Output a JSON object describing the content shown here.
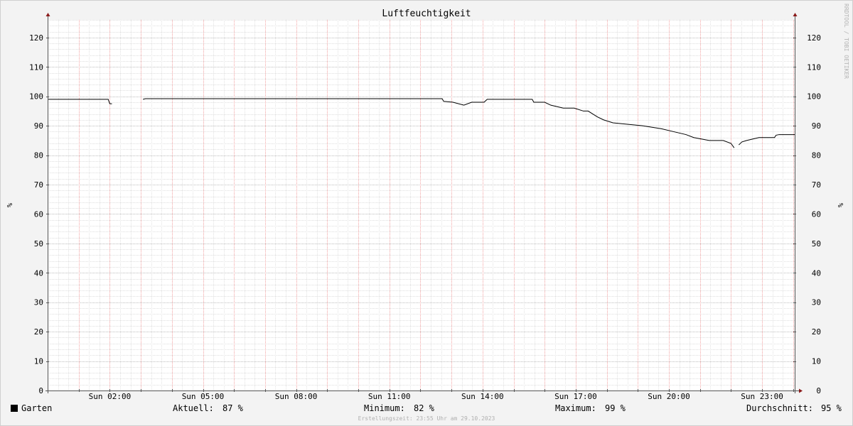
{
  "chart_data": {
    "type": "line",
    "title": "Luftfeuchtigkeit",
    "ylabel": "%",
    "ylim": [
      0,
      126
    ],
    "yticks": [
      0,
      10,
      20,
      30,
      40,
      50,
      60,
      70,
      80,
      90,
      100,
      110,
      120
    ],
    "x_unit": "hour of day (Sun)",
    "xlim": [
      0,
      24.05
    ],
    "xticks": [
      {
        "value": 2,
        "label": "Sun 02:00"
      },
      {
        "value": 5,
        "label": "Sun 05:00"
      },
      {
        "value": 8,
        "label": "Sun 08:00"
      },
      {
        "value": 11,
        "label": "Sun 11:00"
      },
      {
        "value": 14,
        "label": "Sun 14:00"
      },
      {
        "value": 17,
        "label": "Sun 17:00"
      },
      {
        "value": 20,
        "label": "Sun 20:00"
      },
      {
        "value": 23,
        "label": "Sun 23:00"
      }
    ],
    "grid": true,
    "series": [
      {
        "name": "Garten",
        "color": "#000000",
        "segments": [
          {
            "x": [
              0,
              1.95,
              2.0,
              2.07
            ],
            "y": [
              99,
              99,
              97.5,
              97.5
            ]
          },
          {
            "x": [
              3.07,
              3.15,
              12.7,
              12.75,
              13.05,
              13.4,
              13.65,
              14.05,
              14.15,
              15.6,
              15.65,
              16.0,
              16.2,
              16.6,
              16.95,
              17.25,
              17.4,
              17.55,
              17.7,
              17.9,
              18.2,
              19.15,
              19.75,
              20.15,
              20.55,
              20.8,
              21.3,
              21.75,
              22.0,
              22.1
            ],
            "y": [
              99,
              99.2,
              99.2,
              98.3,
              98.0,
              97.0,
              98.0,
              98.0,
              99.0,
              99.0,
              98.0,
              98.0,
              97.0,
              96.0,
              96.0,
              95.0,
              95.0,
              94.0,
              93.0,
              92.0,
              91.0,
              90.0,
              89.0,
              88.0,
              87.0,
              86.0,
              85.0,
              85.0,
              84.0,
              82.5
            ]
          },
          {
            "x": [
              22.25,
              22.35,
              22.5,
              22.9,
              23.4,
              23.45,
              23.55,
              24.05
            ],
            "y": [
              83.5,
              84.5,
              85.0,
              86.0,
              86.0,
              86.8,
              87.0,
              87.0
            ]
          }
        ]
      }
    ]
  },
  "legend": {
    "swatch_color": "#000000",
    "series_label": "Garten",
    "current_label": "Aktuell:",
    "current_value": "87 %",
    "minimum_label": "Minimum:",
    "minimum_value": "82 %",
    "maximum_label": "Maximum:",
    "maximum_value": "99 %",
    "average_label": "Durchschnitt:",
    "average_value": "95 %"
  },
  "footer": {
    "created": "Erstellungszeit: 23:55 Uhr am 29.10.2023"
  },
  "watermark": "RRDTOOL / TOBI OETIKER"
}
